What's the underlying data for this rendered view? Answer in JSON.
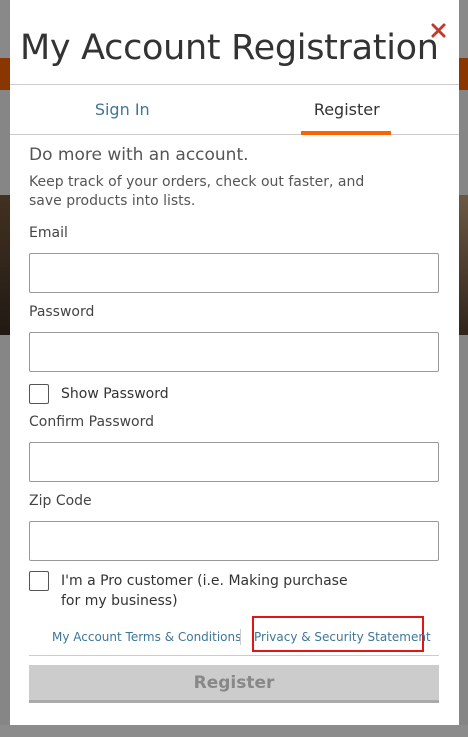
{
  "modal": {
    "title": "My Account Registration",
    "close_icon": "close-icon"
  },
  "tabs": [
    {
      "label": "Sign In",
      "active": false
    },
    {
      "label": "Register",
      "active": true
    }
  ],
  "intro": {
    "heading": "Do more with an account.",
    "text": "Keep track of your orders, check out faster, and save products into lists."
  },
  "fields": {
    "email": {
      "label": "Email",
      "value": ""
    },
    "password": {
      "label": "Password",
      "value": ""
    },
    "confirm_password": {
      "label": "Confirm Password",
      "value": ""
    },
    "zip": {
      "label": "Zip Code",
      "value": ""
    }
  },
  "checkboxes": {
    "show_password": {
      "label": "Show Password",
      "checked": false
    },
    "pro_customer": {
      "label": "I'm a Pro customer (i.e. Making purchase for my business)",
      "checked": false
    }
  },
  "links": {
    "terms": "My Account Terms & Conditions",
    "privacy": "Privacy & Security Statement"
  },
  "register_button": "Register",
  "colors": {
    "accent": "#f96302",
    "link": "#3e7697",
    "highlight_box": "#e01616",
    "close_icon": "#c0392b"
  }
}
